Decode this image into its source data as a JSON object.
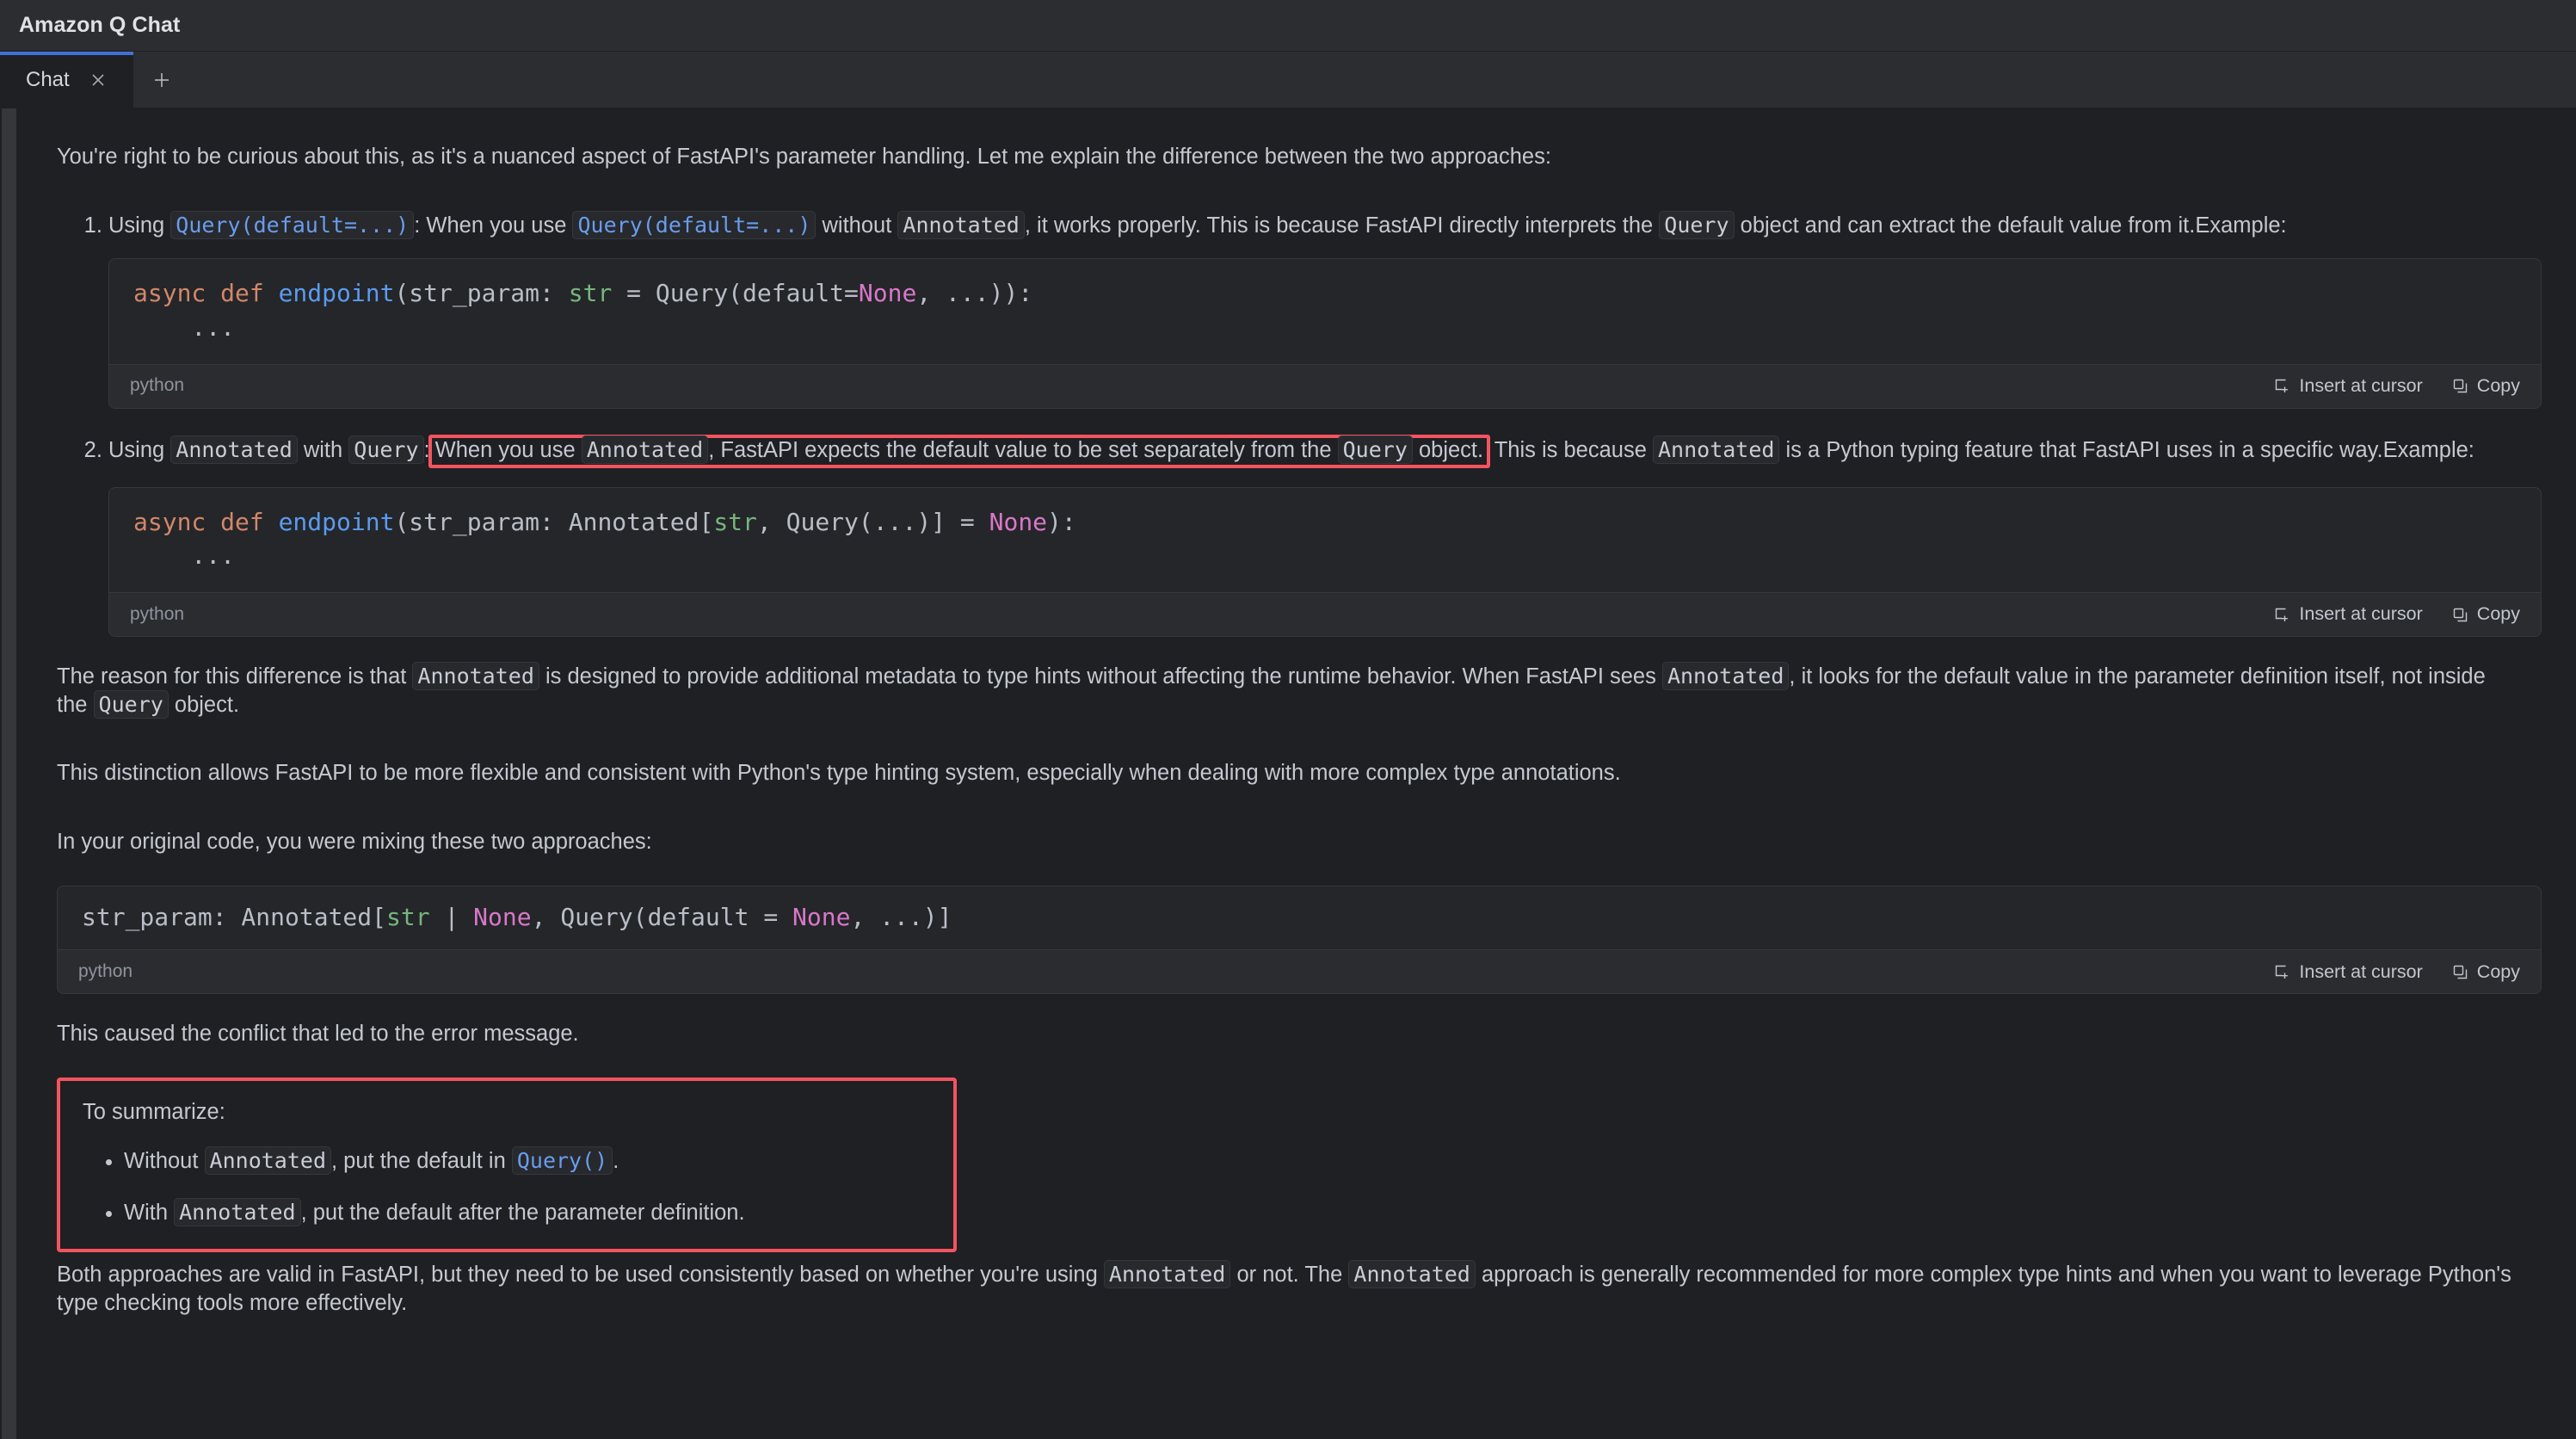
{
  "window": {
    "title": "Amazon Q Chat"
  },
  "tabs": {
    "items": [
      {
        "label": "Chat",
        "close_icon": "close-icon",
        "active": true
      }
    ],
    "new_tab_icon": "plus-icon"
  },
  "conversation": {
    "intro": "You're right to be curious about this, as it's a nuanced aspect of FastAPI's parameter handling. Let me explain the difference between the two approaches:",
    "item1": {
      "t1": "Using ",
      "code1": "Query(default=...)",
      "t2": ": When you use ",
      "code2": "Query(default=...)",
      "t3": " without ",
      "code3": "Annotated",
      "t4": ", it works properly. This is because FastAPI directly interprets the ",
      "code4": "Query",
      "t5": " object and can extract the default value from it.Example:"
    },
    "item2": {
      "t1": "Using ",
      "code1": "Annotated",
      "t2": " with ",
      "code2": "Query",
      "t3": ":",
      "hl_t1": "When you use ",
      "hl_code1": "Annotated",
      "hl_t2": ", FastAPI expects the default value to be set separately from the ",
      "hl_code2": "Query",
      "hl_t3": " object.",
      "t4": " This is because ",
      "code3": "Annotated",
      "t5": " is a Python typing feature that FastAPI uses in a specific way.Example:"
    },
    "para_reason": {
      "t1": "The reason for this difference is that ",
      "code1": "Annotated",
      "t2": " is designed to provide additional metadata to type hints without affecting the runtime behavior. When FastAPI sees ",
      "code2": "Annotated",
      "t3": ", it looks for the default value in the parameter definition itself, not inside the ",
      "code3": "Query",
      "t4": " object."
    },
    "para_distinction": "This distinction allows FastAPI to be more flexible and consistent with Python's type hinting system, especially when dealing with more complex type annotations.",
    "para_original": "In your original code, you were mixing these two approaches:",
    "para_conflict": "This caused the conflict that led to the error message.",
    "summary": {
      "lead": "To summarize:",
      "bullets": [
        {
          "t1": "Without ",
          "code1": "Annotated",
          "t2": ", put the default in ",
          "code2": "Query()",
          "t3": "."
        },
        {
          "t1": "With ",
          "code1": "Annotated",
          "t2": ", put the default after the parameter definition.",
          "code2": "",
          "t3": ""
        }
      ]
    },
    "para_both": {
      "t1": "Both approaches are valid in FastAPI, but they need to be used consistently based on whether you're using ",
      "code1": "Annotated",
      "t2": " or not. The ",
      "code2": "Annotated",
      "t3": " approach is generally recommended for more complex type hints and when you want to leverage Python's type checking tools more effectively."
    }
  },
  "code_blocks": [
    {
      "id": "cb1",
      "lang": "python",
      "tokens": [
        {
          "t": "async def ",
          "c": "kw"
        },
        {
          "t": "endpoint",
          "c": "fn"
        },
        {
          "t": "(str_param: ",
          "c": "pl"
        },
        {
          "t": "str",
          "c": "type"
        },
        {
          "t": " = Query(default=",
          "c": "pl"
        },
        {
          "t": "None",
          "c": "const"
        },
        {
          "t": ", ...)):\n    ...",
          "c": "pl"
        }
      ],
      "plain": "async def endpoint(str_param: str = Query(default=None, ...)):\n    ...",
      "insert_label": "Insert at cursor",
      "copy_label": "Copy"
    },
    {
      "id": "cb2",
      "lang": "python",
      "tokens": [
        {
          "t": "async def ",
          "c": "kw"
        },
        {
          "t": "endpoint",
          "c": "fn"
        },
        {
          "t": "(str_param: Annotated[",
          "c": "pl"
        },
        {
          "t": "str",
          "c": "type"
        },
        {
          "t": ", Query(...)] = ",
          "c": "pl"
        },
        {
          "t": "None",
          "c": "const"
        },
        {
          "t": "):\n    ...",
          "c": "pl"
        }
      ],
      "plain": "async def endpoint(str_param: Annotated[str, Query(...)] = None):\n    ...",
      "insert_label": "Insert at cursor",
      "copy_label": "Copy"
    },
    {
      "id": "cb3",
      "lang": "python",
      "tokens": [
        {
          "t": "str_param: Annotated[",
          "c": "pl"
        },
        {
          "t": "str",
          "c": "type"
        },
        {
          "t": " | ",
          "c": "pl"
        },
        {
          "t": "None",
          "c": "const"
        },
        {
          "t": ", Query(default = ",
          "c": "pl"
        },
        {
          "t": "None",
          "c": "const"
        },
        {
          "t": ", ...)]",
          "c": "pl"
        }
      ],
      "plain": "str_param: Annotated[str | None, Query(default = None, ...)]",
      "insert_label": "Insert at cursor",
      "copy_label": "Copy"
    }
  ],
  "colors": {
    "background": "#1f2023",
    "chrome": "#2b2d30",
    "accent_tab": "#4170d8",
    "annotation_red": "#f4545f",
    "code_bg": "#242629",
    "inline_code_blue": "#6a9ced",
    "syntax_keyword": "#d3866a",
    "syntax_function": "#5b9bf0",
    "syntax_type": "#76b57d",
    "syntax_constant": "#d978c8"
  }
}
